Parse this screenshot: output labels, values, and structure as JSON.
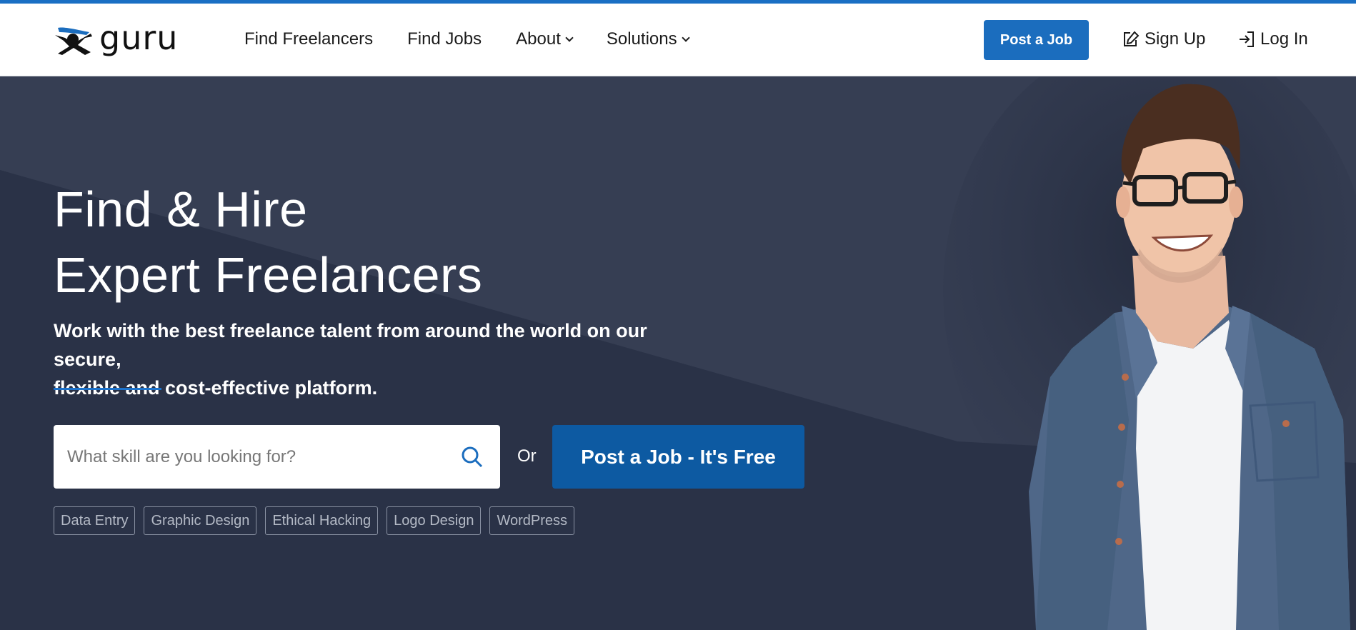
{
  "brand": {
    "name": "guru",
    "accent": "#1b6dbe",
    "header_bg": "#ffffff",
    "hero_bg": "#2a3247"
  },
  "nav": {
    "items": [
      {
        "label": "Find Freelancers",
        "dropdown": false
      },
      {
        "label": "Find Jobs",
        "dropdown": false
      },
      {
        "label": "About",
        "dropdown": true
      },
      {
        "label": "Solutions",
        "dropdown": true
      }
    ]
  },
  "header": {
    "post_job_label": "Post a Job",
    "signup_label": "Sign Up",
    "login_label": "Log In"
  },
  "hero": {
    "title_line1": "Find & Hire",
    "title_line2": "Expert Freelancers",
    "subtitle_line1": "Work with the best freelance talent from around the world on our secure,",
    "subtitle_line2": "flexible and cost-effective platform.",
    "search_placeholder": "What skill are you looking for?",
    "or_label": "Or",
    "cta_label": "Post a Job - It's Free",
    "chips": [
      "Data Entry",
      "Graphic Design",
      "Ethical Hacking",
      "Logo Design",
      "WordPress"
    ]
  },
  "icons": {
    "logo": "guru-logo-icon",
    "signup": "pencil-square-icon",
    "login": "login-arrow-icon",
    "search": "search-icon",
    "chevron": "chevron-down-icon"
  }
}
